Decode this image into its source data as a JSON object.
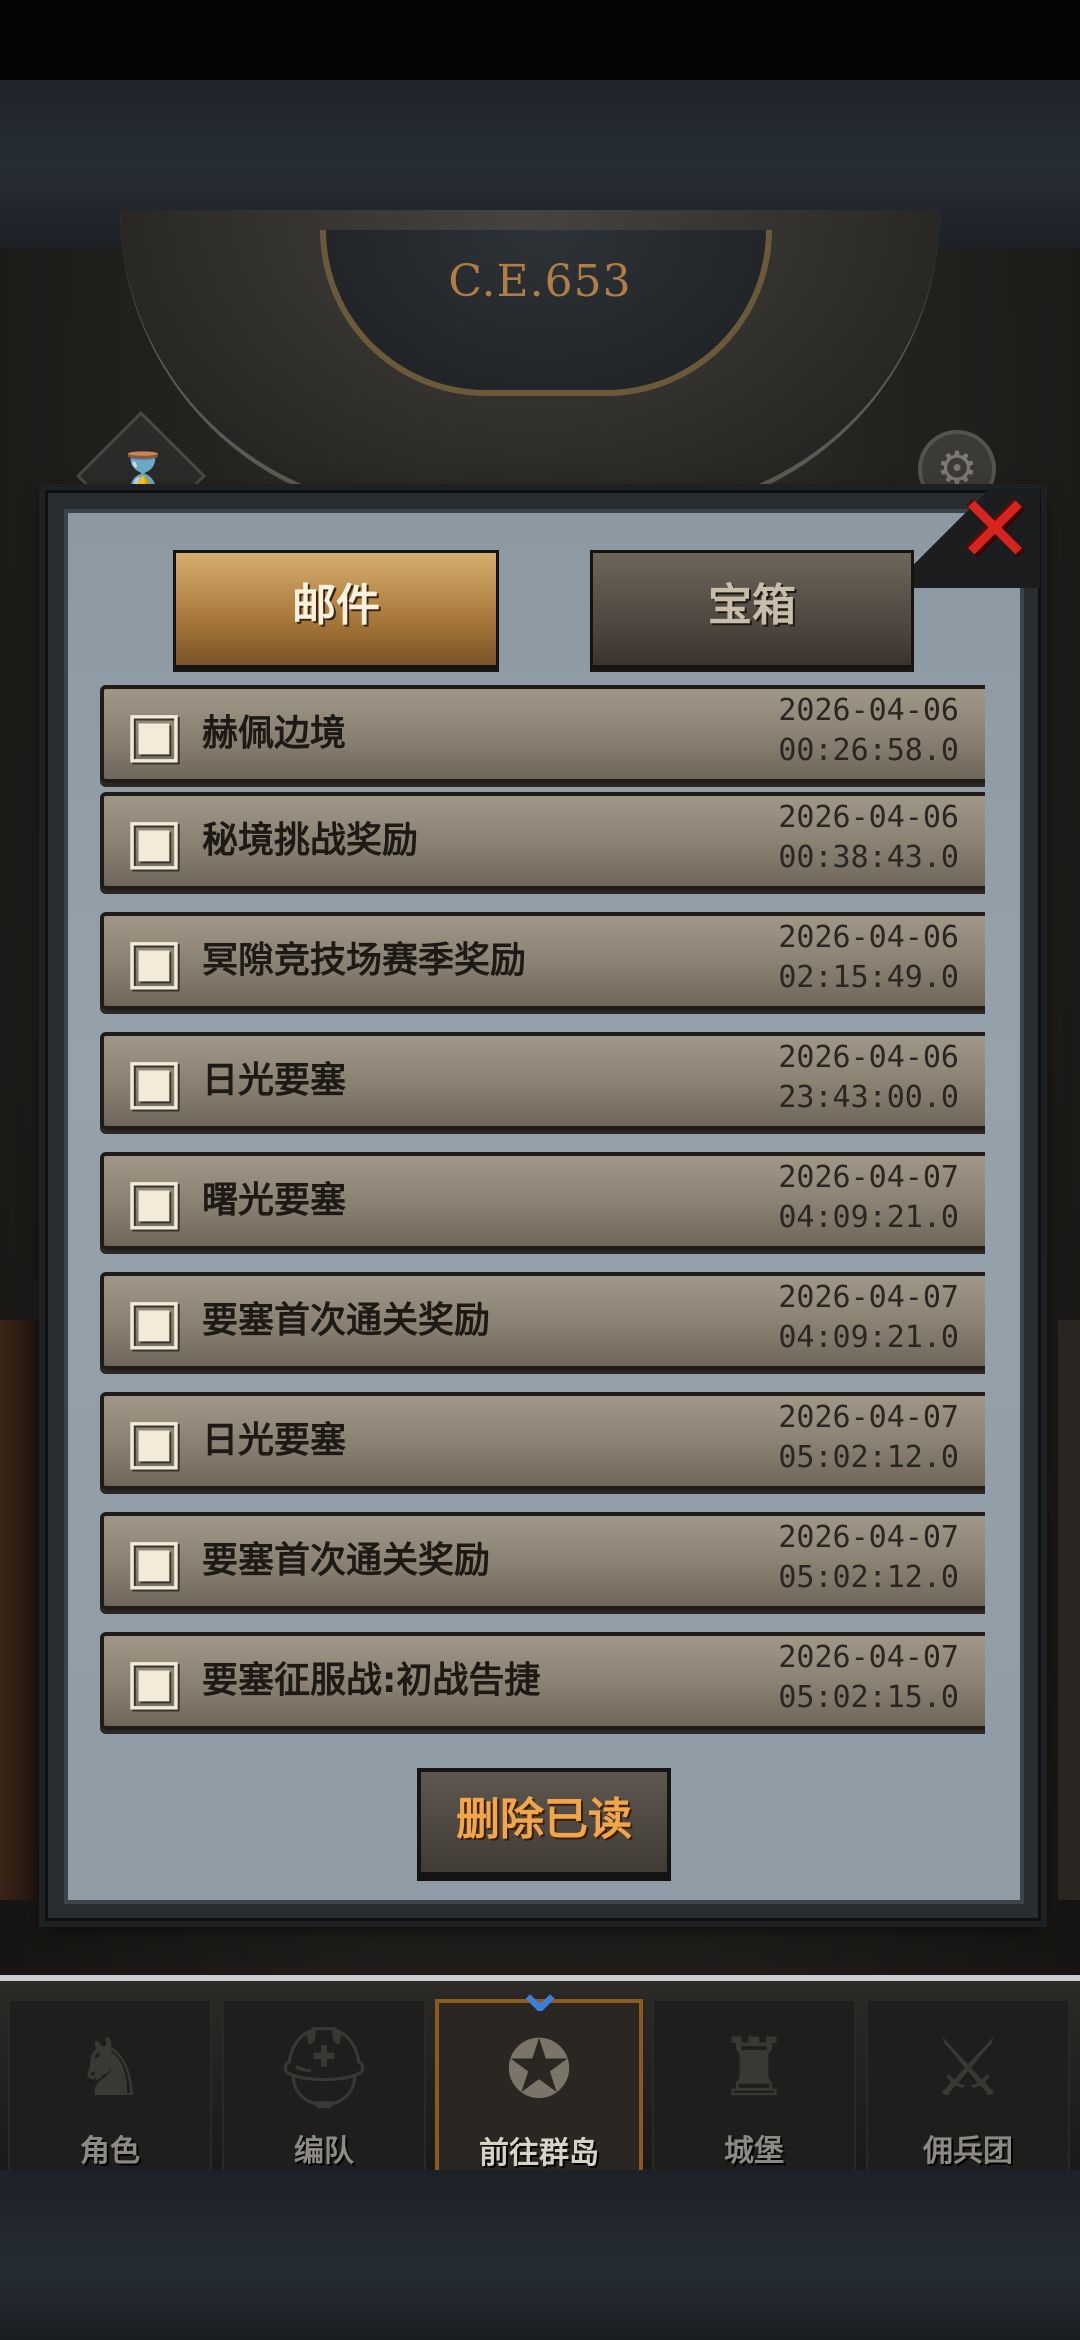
{
  "background": {
    "era_label": "C.E.653"
  },
  "tabs": {
    "mail_label": "邮件",
    "chest_label": "宝箱"
  },
  "mails": [
    {
      "title": "赫佩边境",
      "date": "2026-04-06",
      "time": "00:26:58.0"
    },
    {
      "title": "秘境挑战奖励",
      "date": "2026-04-06",
      "time": "00:38:43.0"
    },
    {
      "title": "冥隙竞技场赛季奖励",
      "date": "2026-04-06",
      "time": "02:15:49.0"
    },
    {
      "title": "日光要塞",
      "date": "2026-04-06",
      "time": "23:43:00.0"
    },
    {
      "title": "曙光要塞",
      "date": "2026-04-07",
      "time": "04:09:21.0"
    },
    {
      "title": "要塞首次通关奖励",
      "date": "2026-04-07",
      "time": "04:09:21.0"
    },
    {
      "title": "日光要塞",
      "date": "2026-04-07",
      "time": "05:02:12.0"
    },
    {
      "title": "要塞首次通关奖励",
      "date": "2026-04-07",
      "time": "05:02:12.0"
    },
    {
      "title": "要塞征服战:初战告捷",
      "date": "2026-04-07",
      "time": "05:02:15.0"
    }
  ],
  "delete_read_label": "删除已读",
  "navbar": {
    "items": [
      {
        "label": "角色",
        "icon": "knight-icon"
      },
      {
        "label": "编队",
        "icon": "helmet-icon"
      },
      {
        "label": "前往群岛",
        "icon": "compass-icon"
      },
      {
        "label": "城堡",
        "icon": "castle-icon"
      },
      {
        "label": "佣兵团",
        "icon": "mercenary-icon"
      }
    ],
    "active_index": 2
  },
  "colors": {
    "accent_gold": "#c4914f",
    "close_red": "#d8241e",
    "delete_text": "#f2a64b"
  }
}
